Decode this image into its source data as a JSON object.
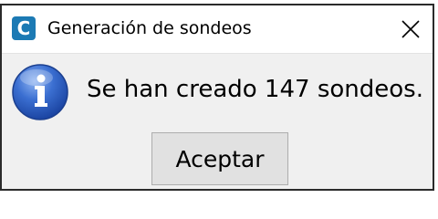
{
  "window": {
    "title": "Generación de sondeos",
    "app_icon_letter": "C",
    "close_glyph": "close-icon"
  },
  "message": {
    "text": "Se han creado 147 sondeos.",
    "icon": "info-icon"
  },
  "buttons": {
    "ok_label": "Aceptar"
  },
  "colors": {
    "app_icon": "#1c7ab4",
    "info_icon": "#2a5fc2",
    "dialog_bg": "#f0f0f0",
    "button_bg": "#e1e1e1"
  }
}
